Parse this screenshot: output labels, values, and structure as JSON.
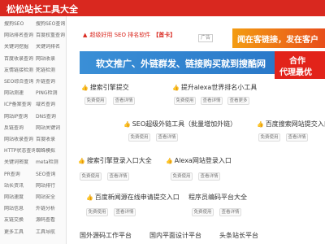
{
  "header": {
    "title": "松松站长工具大全"
  },
  "sidebar": {
    "rows": [
      [
        "搜狗SEO",
        "搜狗SEO查询"
      ],
      [
        "网站排名查询",
        "百度权重查询"
      ],
      [
        "关键词挖掘",
        "关键词排名"
      ],
      [
        "百度收录查询",
        "网站收录"
      ],
      [
        "友情链接检测",
        "死链检测"
      ],
      [
        "SEO综合查询",
        "外链查询"
      ],
      [
        "网站测速",
        "PING检测"
      ],
      [
        "ICP备案查询",
        "域名查询"
      ],
      [
        "网站IP查询",
        "DNS查询"
      ],
      [
        "反链查询",
        "网站关键词"
      ],
      [
        "网站收录查询",
        "百度收录"
      ],
      [
        "HTTP状态查询",
        "蜘蛛模拟"
      ],
      [
        "关键词密度",
        "meta检测"
      ],
      [
        "PR查询",
        "SEO查询"
      ],
      [
        "站长资讯",
        "网站排行"
      ],
      [
        "网站速度",
        "网站安全"
      ],
      [
        "网站信息",
        "外链分析"
      ],
      [
        "友链交换",
        "源码查看"
      ],
      [
        "更多工具",
        "工具导航"
      ]
    ]
  },
  "promo": {
    "icon": "fire-icon",
    "text": "超级好用 SEO 排名软件",
    "tag": "【首卡】",
    "ad_label": "广告"
  },
  "banners": {
    "orange": "闻在客链接，发在客户",
    "blue": "软文推广、外链群发、链接购买就到搜酷网",
    "red_line1": "合作",
    "red_line2": "代理最优"
  },
  "entries": [
    {
      "label": "搜索引擎提交",
      "tags": [
        "免费使用",
        "查看详情"
      ]
    },
    {
      "label": "提升alexa世界排名小工具",
      "tags": [
        "免费使用",
        "查看详情",
        "查看更多"
      ]
    },
    {
      "label": "SEO超级外链工具（批量增加外链）",
      "tags": [
        "免费使用",
        "查看详情"
      ]
    },
    {
      "label": "百度搜索网站提交入口",
      "tags": [
        "免费使用",
        "查看详情"
      ]
    },
    {
      "label": "搜索引擎登录入口大全",
      "tags": [
        "免费使用",
        "查看详情"
      ]
    },
    {
      "label": "Alexa网站登录入口",
      "tags": [
        "免费使用",
        "查看详情"
      ]
    },
    {
      "label": "百度新闻源在线申请提交入口",
      "tags": [
        "免费使用",
        "查看详情"
      ]
    },
    {
      "label": "程序员编码平台大全",
      "tags": [
        "免费使用",
        "查看详情"
      ]
    }
  ],
  "bottom": [
    "国外源码工作平台",
    "国内平面设计平台",
    "头条站长平台"
  ]
}
